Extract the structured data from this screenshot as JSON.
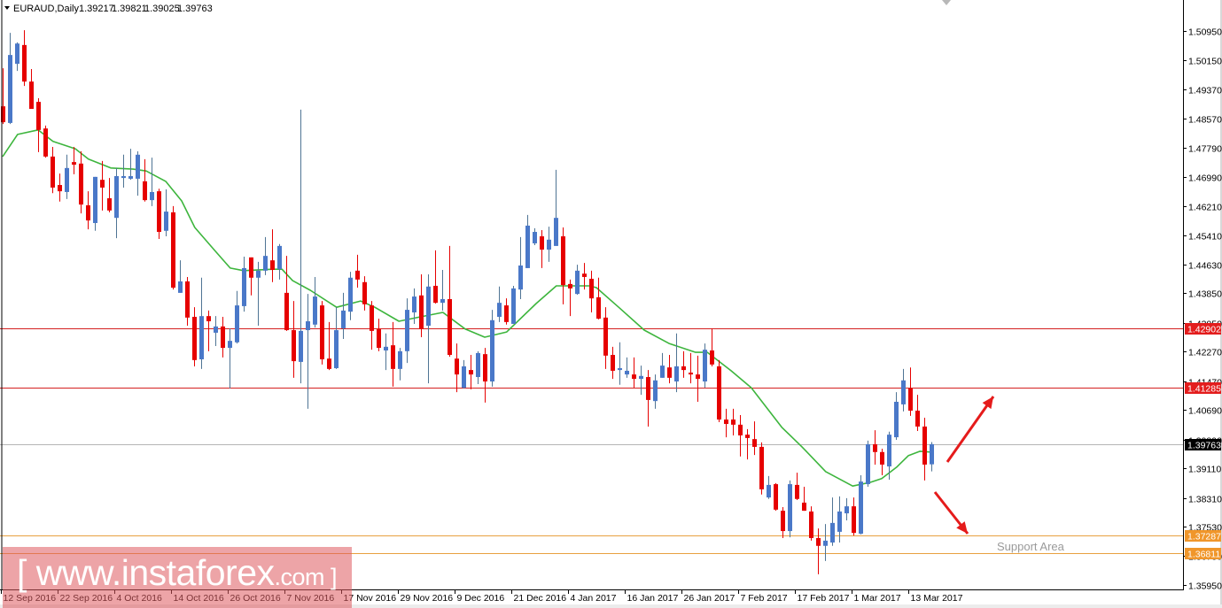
{
  "header": {
    "symbol": "EURAUD,Daily",
    "open": "1.39217",
    "high": "1.39821",
    "low": "1.39025",
    "close": "1.39763",
    "menu_icon": "triangle-down-icon"
  },
  "watermark": {
    "main": "[ www.instaforex",
    "suffix": ".com ]"
  },
  "support_label": "Support Area",
  "chart_data": {
    "type": "candlestick",
    "title": "EURAUD,Daily",
    "colors": {
      "bull": "#4a78c8",
      "bear": "#e60000",
      "bull_wick": "#4f7494",
      "ma": "#3db53d",
      "resistance": "#d42020",
      "current": "#b4b4b4",
      "support": "#e8a040"
    },
    "y_ticks": [
      "1.50950",
      "1.50150",
      "1.49370",
      "1.48570",
      "1.47790",
      "1.46990",
      "1.46210",
      "1.45410",
      "1.44630",
      "1.43850",
      "1.43050",
      "1.42270",
      "1.41470",
      "1.40690",
      "1.39890",
      "1.39110",
      "1.38310",
      "1.37530",
      "1.36730",
      "1.35950"
    ],
    "ylim": [
      1.3595,
      1.5095
    ],
    "x_labels": [
      {
        "bar": 0,
        "label": "12 Sep 2016"
      },
      {
        "bar": 8,
        "label": "22 Sep 2016"
      },
      {
        "bar": 16,
        "label": "4 Oct 2016"
      },
      {
        "bar": 24,
        "label": "14 Oct 2016"
      },
      {
        "bar": 32,
        "label": "26 Oct 2016"
      },
      {
        "bar": 40,
        "label": "7 Nov 2016"
      },
      {
        "bar": 48,
        "label": "17 Nov 2016"
      },
      {
        "bar": 56,
        "label": "29 Nov 2016"
      },
      {
        "bar": 64,
        "label": "9 Dec 2016"
      },
      {
        "bar": 72,
        "label": "21 Dec 2016"
      },
      {
        "bar": 80,
        "label": "4 Jan 2017"
      },
      {
        "bar": 88,
        "label": "16 Jan 2017"
      },
      {
        "bar": 96,
        "label": "26 Jan 2017"
      },
      {
        "bar": 104,
        "label": "7 Feb 2017"
      },
      {
        "bar": 112,
        "label": "17 Feb 2017"
      },
      {
        "bar": 120,
        "label": "1 Mar 2017"
      },
      {
        "bar": 128,
        "label": "13 Mar 2017"
      }
    ],
    "levels": [
      {
        "value": 1.42902,
        "label": "1.42902",
        "kind": "resistance"
      },
      {
        "value": 1.41285,
        "label": "1.41285",
        "kind": "resistance"
      },
      {
        "value": 1.39763,
        "label": "1.39763",
        "kind": "current"
      },
      {
        "value": 1.37287,
        "label": "1.37287",
        "kind": "support"
      },
      {
        "value": 1.36811,
        "label": "1.36811",
        "kind": "support"
      }
    ],
    "ohlc": [
      [
        1.4891,
        1.4994,
        1.4843,
        1.4848
      ],
      [
        1.4846,
        1.509,
        1.4843,
        1.503
      ],
      [
        1.5006,
        1.5064,
        1.4987,
        1.5061
      ],
      [
        1.5057,
        1.5097,
        1.4946,
        1.4958
      ],
      [
        1.4958,
        1.4992,
        1.4884,
        1.4884
      ],
      [
        1.4903,
        1.4913,
        1.4767,
        1.4827
      ],
      [
        1.4831,
        1.4839,
        1.4752,
        1.4755
      ],
      [
        1.4755,
        1.4781,
        1.4656,
        1.4671
      ],
      [
        1.4678,
        1.4709,
        1.4633,
        1.4661
      ],
      [
        1.4659,
        1.476,
        1.464,
        1.4724
      ],
      [
        1.474,
        1.4781,
        1.4707,
        1.4733
      ],
      [
        1.4736,
        1.4769,
        1.4601,
        1.4625
      ],
      [
        1.4623,
        1.4661,
        1.4558,
        1.4582
      ],
      [
        1.4575,
        1.47,
        1.4554,
        1.47
      ],
      [
        1.4692,
        1.4743,
        1.4609,
        1.4671
      ],
      [
        1.4642,
        1.4697,
        1.4604,
        1.4609
      ],
      [
        1.4589,
        1.4724,
        1.4534,
        1.4702
      ],
      [
        1.4697,
        1.476,
        1.4671,
        1.4702
      ],
      [
        1.4695,
        1.4776,
        1.4692,
        1.4702
      ],
      [
        1.4695,
        1.4769,
        1.4649,
        1.476
      ],
      [
        1.4688,
        1.4748,
        1.4633,
        1.4637
      ],
      [
        1.4637,
        1.4752,
        1.4621,
        1.4659
      ],
      [
        1.4661,
        1.4668,
        1.4532,
        1.4551
      ],
      [
        1.4554,
        1.4666,
        1.4539,
        1.4606
      ],
      [
        1.4604,
        1.4621,
        1.4395,
        1.44
      ],
      [
        1.4386,
        1.4474,
        1.4386,
        1.4417
      ],
      [
        1.4417,
        1.4429,
        1.4297,
        1.4319
      ],
      [
        1.4321,
        1.4347,
        1.4187,
        1.4204
      ],
      [
        1.4206,
        1.4427,
        1.418,
        1.4323
      ],
      [
        1.4323,
        1.4338,
        1.4228,
        1.4309
      ],
      [
        1.4278,
        1.4323,
        1.4242,
        1.4295
      ],
      [
        1.4295,
        1.4321,
        1.4211,
        1.4237
      ],
      [
        1.4237,
        1.429,
        1.4127,
        1.4256
      ],
      [
        1.4252,
        1.4391,
        1.4249,
        1.4352
      ],
      [
        1.435,
        1.4484,
        1.4335,
        1.4453
      ],
      [
        1.4482,
        1.4482,
        1.4379,
        1.4427
      ],
      [
        1.4427,
        1.447,
        1.4297,
        1.4446
      ],
      [
        1.4446,
        1.4537,
        1.4434,
        1.4486
      ],
      [
        1.4474,
        1.4558,
        1.4415,
        1.4448
      ],
      [
        1.445,
        1.4518,
        1.4422,
        1.4513
      ],
      [
        1.4386,
        1.4486,
        1.4283,
        1.4285
      ],
      [
        1.4285,
        1.4364,
        1.4156,
        1.4201
      ],
      [
        1.4199,
        1.4882,
        1.4141,
        1.4283
      ],
      [
        1.4285,
        1.4383,
        1.4072,
        1.4309
      ],
      [
        1.43,
        1.4429,
        1.4292,
        1.4376
      ],
      [
        1.4352,
        1.4364,
        1.4192,
        1.4206
      ],
      [
        1.4208,
        1.4307,
        1.4177,
        1.418
      ],
      [
        1.4182,
        1.4347,
        1.418,
        1.4285
      ],
      [
        1.429,
        1.4386,
        1.4261,
        1.4338
      ],
      [
        1.4335,
        1.4443,
        1.4312,
        1.4427
      ],
      [
        1.4446,
        1.4489,
        1.44,
        1.4422
      ],
      [
        1.4415,
        1.4431,
        1.4338,
        1.4355
      ],
      [
        1.4352,
        1.4364,
        1.4232,
        1.4283
      ],
      [
        1.4288,
        1.4316,
        1.4228,
        1.4237
      ],
      [
        1.423,
        1.4276,
        1.4177,
        1.424
      ],
      [
        1.4244,
        1.4307,
        1.4132,
        1.418
      ],
      [
        1.418,
        1.4237,
        1.4149,
        1.4228
      ],
      [
        1.4228,
        1.4371,
        1.4196,
        1.434
      ],
      [
        1.4333,
        1.4398,
        1.4302,
        1.4376
      ],
      [
        1.4379,
        1.4436,
        1.4266,
        1.4288
      ],
      [
        1.4297,
        1.4436,
        1.4141,
        1.4403
      ],
      [
        1.4405,
        1.4501,
        1.4357,
        1.4359
      ],
      [
        1.4359,
        1.4448,
        1.4338,
        1.4369
      ],
      [
        1.4369,
        1.4513,
        1.4213,
        1.4218
      ],
      [
        1.4208,
        1.4249,
        1.4117,
        1.4165
      ],
      [
        1.4129,
        1.4204,
        1.4127,
        1.4187
      ],
      [
        1.4177,
        1.4218,
        1.4125,
        1.4165
      ],
      [
        1.4158,
        1.4228,
        1.4139,
        1.4223
      ],
      [
        1.422,
        1.4237,
        1.4089,
        1.4146
      ],
      [
        1.4146,
        1.434,
        1.4132,
        1.4312
      ],
      [
        1.4321,
        1.4403,
        1.4307,
        1.4359
      ],
      [
        1.4352,
        1.4371,
        1.43,
        1.4307
      ],
      [
        1.4302,
        1.4405,
        1.4302,
        1.4398
      ],
      [
        1.4395,
        1.4537,
        1.4369,
        1.446
      ],
      [
        1.4453,
        1.4597,
        1.4453,
        1.4568
      ],
      [
        1.452,
        1.4561,
        1.4515,
        1.4551
      ],
      [
        1.4539,
        1.4556,
        1.4453,
        1.4503
      ],
      [
        1.4503,
        1.4565,
        1.447,
        1.453
      ],
      [
        1.4513,
        1.4719,
        1.4513,
        1.4589
      ],
      [
        1.4539,
        1.4563,
        1.4355,
        1.4407
      ],
      [
        1.441,
        1.4422,
        1.4323,
        1.4398
      ],
      [
        1.4383,
        1.4462,
        1.4381,
        1.4446
      ],
      [
        1.4438,
        1.4467,
        1.4395,
        1.4429
      ],
      [
        1.4424,
        1.4446,
        1.4333,
        1.4371
      ],
      [
        1.4374,
        1.4427,
        1.4314,
        1.4316
      ],
      [
        1.4319,
        1.4347,
        1.418,
        1.4216
      ],
      [
        1.4218,
        1.424,
        1.4153,
        1.4175
      ],
      [
        1.4177,
        1.4252,
        1.4137,
        1.4182
      ],
      [
        1.4165,
        1.4211,
        1.4156,
        1.4175
      ],
      [
        1.4165,
        1.4211,
        1.4129,
        1.4153
      ],
      [
        1.4153,
        1.4189,
        1.411,
        1.4161
      ],
      [
        1.4158,
        1.4177,
        1.4024,
        1.4096
      ],
      [
        1.4093,
        1.4165,
        1.4072,
        1.4149
      ],
      [
        1.4156,
        1.4223,
        1.4156,
        1.4189
      ],
      [
        1.4184,
        1.4218,
        1.4141,
        1.4156
      ],
      [
        1.4146,
        1.4276,
        1.4117,
        1.4187
      ],
      [
        1.4187,
        1.4228,
        1.4156,
        1.4177
      ],
      [
        1.417,
        1.4223,
        1.4141,
        1.4165
      ],
      [
        1.4165,
        1.4216,
        1.4091,
        1.4153
      ],
      [
        1.4146,
        1.4249,
        1.4129,
        1.4232
      ],
      [
        1.423,
        1.429,
        1.4187,
        1.4192
      ],
      [
        1.4187,
        1.4204,
        1.4036,
        1.4043
      ],
      [
        1.4043,
        1.4072,
        1.3995,
        1.4031
      ],
      [
        1.4043,
        1.4072,
        1.4,
        1.4029
      ],
      [
        1.4029,
        1.4055,
        1.3943,
        1.4
      ],
      [
        1.4002,
        1.4017,
        1.3935,
        1.3993
      ],
      [
        1.399,
        1.4038,
        1.3947,
        1.3969
      ],
      [
        1.3969,
        1.3981,
        1.384,
        1.3854
      ],
      [
        1.3832,
        1.389,
        1.3828,
        1.3866
      ],
      [
        1.3868,
        1.3871,
        1.3796,
        1.3799
      ],
      [
        1.3796,
        1.3806,
        1.3722,
        1.3741
      ],
      [
        1.3741,
        1.3878,
        1.3724,
        1.3868
      ],
      [
        1.3866,
        1.3899,
        1.3825,
        1.3828
      ],
      [
        1.3818,
        1.3861,
        1.3796,
        1.3796
      ],
      [
        1.3794,
        1.3808,
        1.3715,
        1.3722
      ],
      [
        1.3722,
        1.3748,
        1.3624,
        1.3701
      ],
      [
        1.3701,
        1.376,
        1.366,
        1.3715
      ],
      [
        1.371,
        1.3832,
        1.3701,
        1.3763
      ],
      [
        1.3739,
        1.3835,
        1.371,
        1.3794
      ],
      [
        1.3789,
        1.383,
        1.377,
        1.3808
      ],
      [
        1.3808,
        1.3832,
        1.3729,
        1.3736
      ],
      [
        1.3734,
        1.3892,
        1.3732,
        1.3875
      ],
      [
        1.3868,
        1.3986,
        1.3861,
        1.3976
      ],
      [
        1.3976,
        1.4014,
        1.3921,
        1.3955
      ],
      [
        1.3955,
        1.3964,
        1.3892,
        1.3921
      ],
      [
        1.3916,
        1.401,
        1.388,
        1.4002
      ],
      [
        1.3995,
        1.4117,
        1.3988,
        1.4091
      ],
      [
        1.4084,
        1.418,
        1.4065,
        1.4149
      ],
      [
        1.4127,
        1.4184,
        1.4053,
        1.4067
      ],
      [
        1.4067,
        1.411,
        1.4012,
        1.4024
      ],
      [
        1.4024,
        1.4048,
        1.3878,
        1.3921
      ],
      [
        1.39217,
        1.39821,
        1.39025,
        1.39763
      ]
    ],
    "moving_average": [
      [
        0,
        1.4755
      ],
      [
        2.1,
        1.4815
      ],
      [
        5,
        1.4827
      ],
      [
        7.1,
        1.4796
      ],
      [
        10.25,
        1.4776
      ],
      [
        12.1,
        1.4748
      ],
      [
        15.25,
        1.4724
      ],
      [
        18.4,
        1.4721
      ],
      [
        20.25,
        1.4716
      ],
      [
        23,
        1.4688
      ],
      [
        25.25,
        1.4635
      ],
      [
        27.1,
        1.4563
      ],
      [
        29.9,
        1.4501
      ],
      [
        32.1,
        1.4453
      ],
      [
        34,
        1.4446
      ],
      [
        38.1,
        1.445
      ],
      [
        39.4,
        1.445
      ],
      [
        40.9,
        1.4419
      ],
      [
        43.4,
        1.4393
      ],
      [
        47.1,
        1.4347
      ],
      [
        50.5,
        1.4364
      ],
      [
        52.5,
        1.4347
      ],
      [
        55.9,
        1.4309
      ],
      [
        58.4,
        1.4319
      ],
      [
        62.1,
        1.4333
      ],
      [
        65.25,
        1.4288
      ],
      [
        68,
        1.4266
      ],
      [
        71.1,
        1.428
      ],
      [
        75.25,
        1.4357
      ],
      [
        78.1,
        1.4405
      ],
      [
        82.75,
        1.4405
      ],
      [
        83.75,
        1.44
      ],
      [
        86.9,
        1.4347
      ],
      [
        90.5,
        1.4285
      ],
      [
        94,
        1.4249
      ],
      [
        97.75,
        1.4225
      ],
      [
        99.4,
        1.4225
      ],
      [
        102.75,
        1.4175
      ],
      [
        105.6,
        1.4129
      ],
      [
        109.9,
        1.4022
      ],
      [
        112.75,
        1.3969
      ],
      [
        116.1,
        1.3902
      ],
      [
        119.9,
        1.3863
      ],
      [
        122.4,
        1.3873
      ],
      [
        124,
        1.3883
      ],
      [
        126.1,
        1.3914
      ],
      [
        127.75,
        1.3945
      ],
      [
        129.4,
        1.3957
      ],
      [
        130.9,
        1.3955
      ]
    ],
    "annotations": [
      "arrow-up (breakout scenario)",
      "arrow-down (toward support)"
    ]
  }
}
